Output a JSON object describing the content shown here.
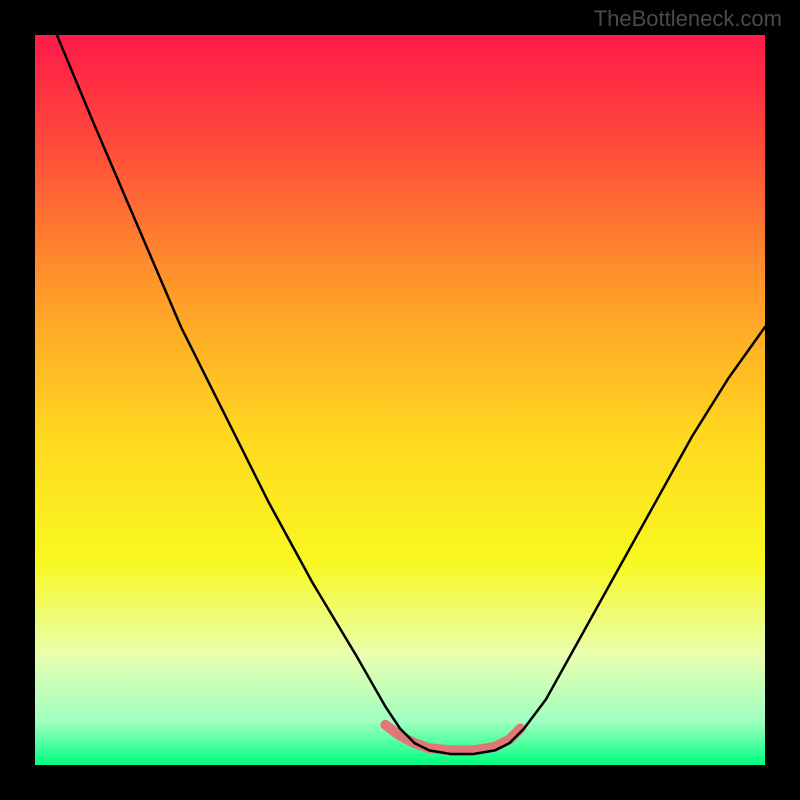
{
  "watermark": "TheBottleneck.com",
  "chart_data": {
    "type": "line",
    "title": "",
    "xlabel": "",
    "ylabel": "",
    "xlim": [
      0,
      100
    ],
    "ylim": [
      0,
      100
    ],
    "gradient_stops": [
      {
        "offset": 0,
        "color": "#ff1a4a"
      },
      {
        "offset": 0.15,
        "color": "#ff4a3a"
      },
      {
        "offset": 0.35,
        "color": "#ff9a2a"
      },
      {
        "offset": 0.55,
        "color": "#ffd820"
      },
      {
        "offset": 0.72,
        "color": "#f8f820"
      },
      {
        "offset": 0.85,
        "color": "#e8ffb0"
      },
      {
        "offset": 0.94,
        "color": "#a0ffc0"
      },
      {
        "offset": 1.0,
        "color": "#00ff80"
      }
    ],
    "series": [
      {
        "name": "bottleneck-curve",
        "color": "#000000",
        "stroke_width": 2.5,
        "points": [
          {
            "x": 3,
            "y": 100
          },
          {
            "x": 8,
            "y": 88
          },
          {
            "x": 14,
            "y": 74
          },
          {
            "x": 20,
            "y": 60
          },
          {
            "x": 26,
            "y": 48
          },
          {
            "x": 32,
            "y": 36
          },
          {
            "x": 38,
            "y": 25
          },
          {
            "x": 44,
            "y": 15
          },
          {
            "x": 48,
            "y": 8
          },
          {
            "x": 50,
            "y": 5
          },
          {
            "x": 52,
            "y": 3
          },
          {
            "x": 54,
            "y": 2
          },
          {
            "x": 57,
            "y": 1.5
          },
          {
            "x": 60,
            "y": 1.5
          },
          {
            "x": 63,
            "y": 2
          },
          {
            "x": 65,
            "y": 3
          },
          {
            "x": 67,
            "y": 5
          },
          {
            "x": 70,
            "y": 9
          },
          {
            "x": 75,
            "y": 18
          },
          {
            "x": 80,
            "y": 27
          },
          {
            "x": 85,
            "y": 36
          },
          {
            "x": 90,
            "y": 45
          },
          {
            "x": 95,
            "y": 53
          },
          {
            "x": 100,
            "y": 60
          }
        ]
      },
      {
        "name": "highlight-band",
        "color": "#e07878",
        "stroke_width": 10,
        "points": [
          {
            "x": 48,
            "y": 5.5
          },
          {
            "x": 50,
            "y": 4
          },
          {
            "x": 52,
            "y": 3
          },
          {
            "x": 54,
            "y": 2.3
          },
          {
            "x": 57,
            "y": 2
          },
          {
            "x": 60,
            "y": 2
          },
          {
            "x": 63,
            "y": 2.5
          },
          {
            "x": 65,
            "y": 3.5
          },
          {
            "x": 66.5,
            "y": 5
          }
        ]
      }
    ]
  }
}
